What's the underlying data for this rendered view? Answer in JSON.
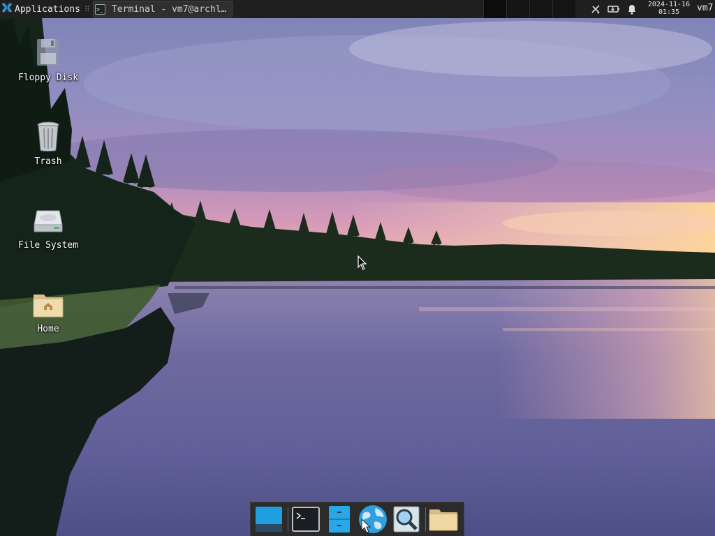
{
  "panel": {
    "applications_label": "Applications",
    "separator": "⠿",
    "task_title": "Terminal - vm7@archl…",
    "task_icon_glyph": ">_",
    "clock_date": "2024-11-16",
    "clock_time": "01:35",
    "user": "vm7",
    "tray_icons": [
      "network-disconnected-icon",
      "battery-icon",
      "notification-bell-icon"
    ]
  },
  "desktop_icons": [
    {
      "label": "Floppy Disk",
      "icon": "floppy-disk-icon"
    },
    {
      "label": "Trash",
      "icon": "trash-icon"
    },
    {
      "label": "File System",
      "icon": "hard-drive-icon"
    },
    {
      "label": "Home",
      "icon": "home-folder-icon"
    }
  ],
  "dock": {
    "items": [
      {
        "name": "show-desktop",
        "icon": "desktop-icon"
      },
      {
        "name": "terminal",
        "icon": "terminal-icon"
      },
      {
        "name": "file-manager",
        "icon": "file-cabinet-icon"
      },
      {
        "name": "web-browser",
        "icon": "globe-icon"
      },
      {
        "name": "app-finder",
        "icon": "magnifier-icon"
      },
      {
        "name": "folder",
        "icon": "folder-icon"
      }
    ]
  },
  "colors": {
    "panel_bg": "#1f1f1f",
    "panel_text": "#e8e8e8",
    "dock_bg": "#2b2b2b",
    "accent": "#2aa7e8"
  }
}
